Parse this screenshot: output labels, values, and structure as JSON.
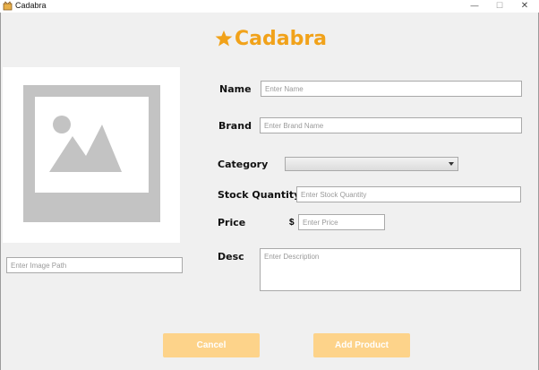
{
  "window": {
    "title": "Cadabra",
    "minimize_glyph": "—",
    "maximize_glyph": "☐",
    "close_glyph": "✕"
  },
  "logo": {
    "text": "Cadabra",
    "color": "#f1a21a",
    "icon": "star-icon"
  },
  "image_panel": {
    "icon": "image-placeholder-icon",
    "path_placeholder": "Enter Image Path",
    "path_value": ""
  },
  "form": {
    "name": {
      "label": "Name",
      "placeholder": "Enter Name",
      "value": ""
    },
    "brand": {
      "label": "Brand",
      "placeholder": "Enter Brand Name",
      "value": ""
    },
    "category": {
      "label": "Category",
      "selected": ""
    },
    "stock": {
      "label": "Stock Quantity",
      "placeholder": "Enter Stock Quantity",
      "value": ""
    },
    "price": {
      "label": "Price",
      "currency": "$",
      "placeholder": "Enter Price",
      "value": ""
    },
    "desc": {
      "label": "Desc",
      "placeholder": "Enter Description",
      "value": ""
    }
  },
  "buttons": {
    "cancel": "Cancel",
    "add": "Add Product",
    "color": "#fdd38a"
  }
}
